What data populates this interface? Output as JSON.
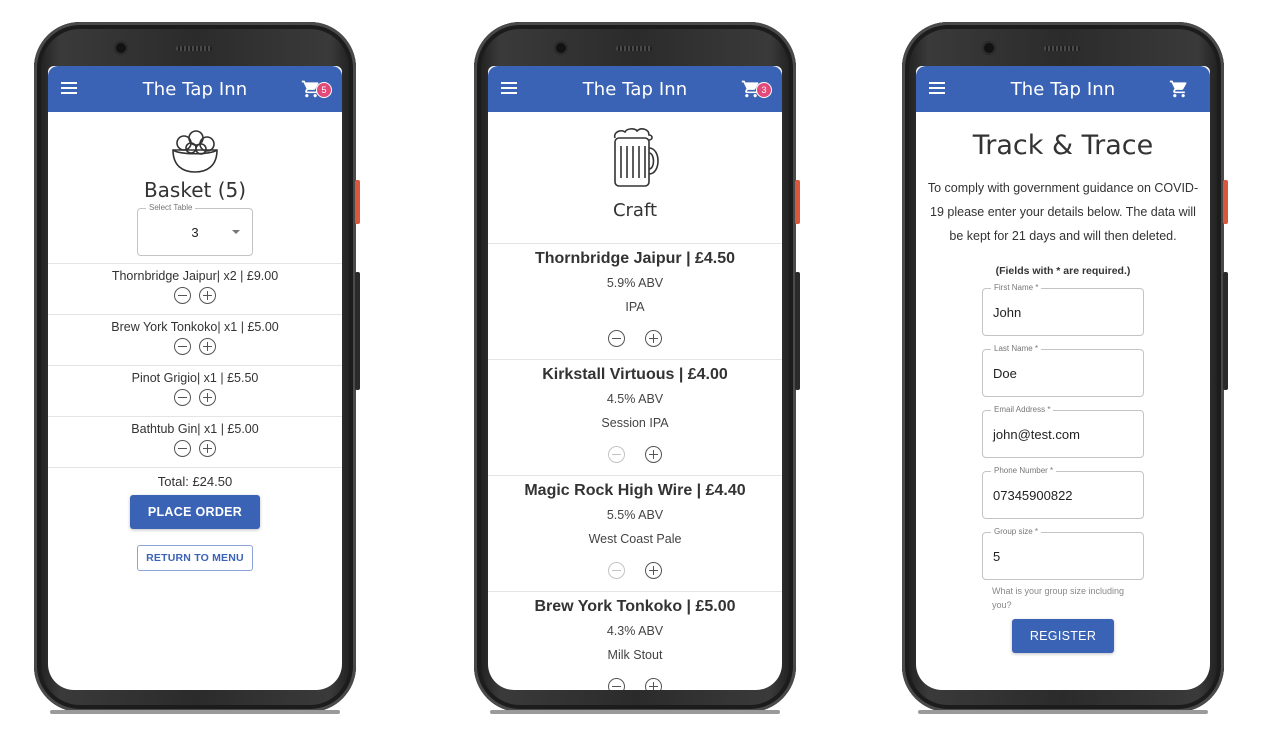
{
  "app": {
    "title": "The Tap Inn"
  },
  "colors": {
    "brand": "#3a63b6",
    "badge": "#e24a7a"
  },
  "icons": {
    "menu": "menu-icon",
    "cart": "cart-icon",
    "basket": "basket-icon",
    "beer": "beer-mug-icon"
  },
  "basket_screen": {
    "cart_count": "5",
    "heading": "Basket (5)",
    "table_label": "Select Table",
    "table_value": "3",
    "items": [
      {
        "text": "Thornbridge Jaipur| x2 | £9.00"
      },
      {
        "text": "Brew York Tonkoko| x1 | £5.00"
      },
      {
        "text": "Pinot Grigio| x1 | £5.50"
      },
      {
        "text": "Bathtub Gin| x1 | £5.00"
      }
    ],
    "total": "Total: £24.50",
    "place_order": "PLACE ORDER",
    "return_to_menu": "RETURN TO MENU"
  },
  "menu_screen": {
    "cart_count": "3",
    "category": "Craft",
    "drinks": [
      {
        "name": "Thornbridge Jaipur | £4.50",
        "abv": "5.9% ABV",
        "style": "IPA"
      },
      {
        "name": "Kirkstall Virtuous | £4.00",
        "abv": "4.5% ABV",
        "style": "Session IPA"
      },
      {
        "name": "Magic Rock High Wire | £4.40",
        "abv": "5.5% ABV",
        "style": "West Coast Pale"
      },
      {
        "name": "Brew York Tonkoko | £5.00",
        "abv": "4.3% ABV",
        "style": "Milk Stout"
      }
    ]
  },
  "trace_screen": {
    "heading": "Track & Trace",
    "intro": "To comply with government guidance on COVID-19 please enter your details below. The data will be kept for 21 days and will then deleted.",
    "required_note": "(Fields with * are required.)",
    "fields": {
      "first_name": {
        "label": "First Name *",
        "value": "John"
      },
      "last_name": {
        "label": "Last Name *",
        "value": "Doe"
      },
      "email": {
        "label": "Email Address *",
        "value": "john@test.com"
      },
      "phone": {
        "label": "Phone Number *",
        "value": "07345900822"
      },
      "group_size": {
        "label": "Group size *",
        "value": "5"
      }
    },
    "group_helper": "What is your group size including you?",
    "register": "REGISTER"
  }
}
